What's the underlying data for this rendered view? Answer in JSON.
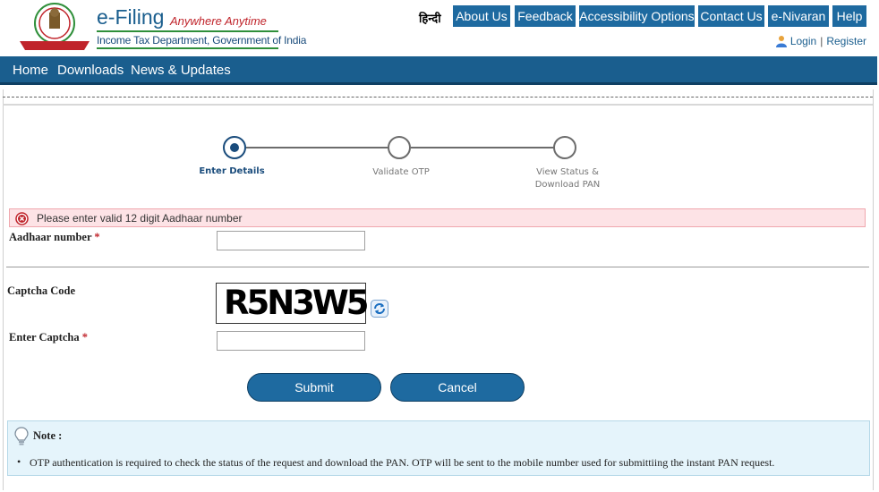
{
  "brand": {
    "title": "e-Filing",
    "tagline": "Anywhere Anytime",
    "subtitle": "Income Tax Department, Government of India"
  },
  "topnav": {
    "language": "हिन्दी",
    "items": [
      "About Us",
      "Feedback",
      "Accessibility Options",
      "Contact Us",
      "e-Nivaran",
      "Help"
    ]
  },
  "account": {
    "login": "Login",
    "separator": "|",
    "register": "Register"
  },
  "mainnav": {
    "items": [
      "Home",
      "Downloads",
      "News & Updates"
    ]
  },
  "steps": [
    {
      "label": "Enter Details",
      "state": "active"
    },
    {
      "label": "Validate OTP",
      "state": "pending"
    },
    {
      "label_line1": "View Status &",
      "label_line2": "Download PAN",
      "state": "pending"
    }
  ],
  "error": {
    "message": "Please enter valid 12 digit Aadhaar number"
  },
  "form": {
    "aadhaar_label": "Aadhaar number",
    "aadhaar_value": "",
    "captcha_label": "Captcha Code",
    "captcha_text": "R5N3W5",
    "enter_captcha_label": "Enter Captcha",
    "enter_captcha_value": "",
    "required_mark": "*",
    "submit_label": "Submit",
    "cancel_label": "Cancel"
  },
  "note": {
    "title": "Note :",
    "items": [
      "OTP authentication is required to check the status of the request and download the PAN. OTP will be sent to the mobile number used for submittiing the instant PAN request."
    ]
  },
  "colors": {
    "primary": "#1a5e8e",
    "button": "#1e6aa0",
    "error_bg": "#fde3e6",
    "note_bg": "#e5f4fb",
    "accent_red": "#c0242b"
  }
}
